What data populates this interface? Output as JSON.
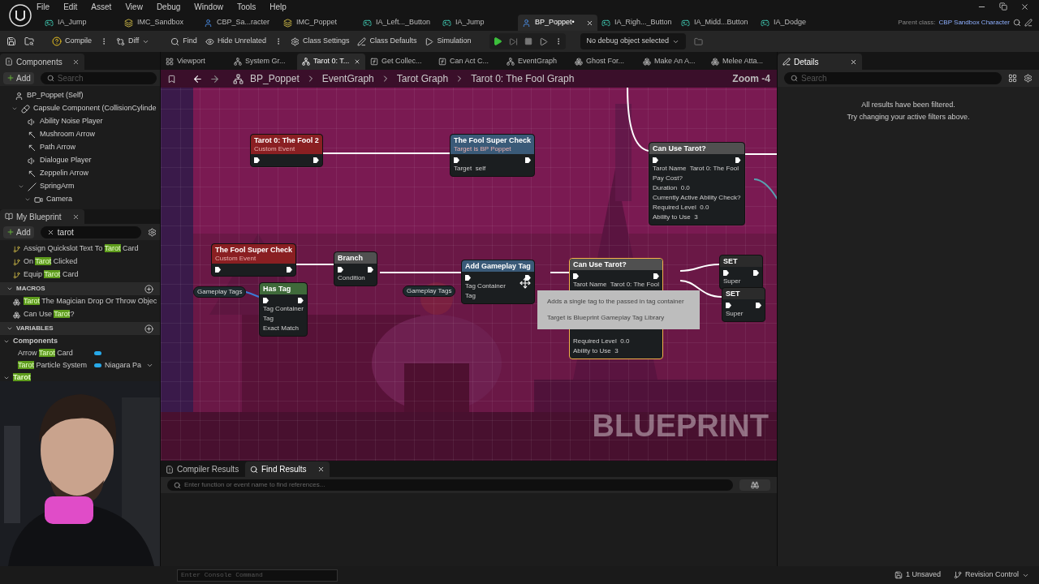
{
  "menu": [
    "File",
    "Edit",
    "Asset",
    "View",
    "Debug",
    "Window",
    "Tools",
    "Help"
  ],
  "file_tabs": [
    {
      "label": "IA_Jump",
      "kind": "action",
      "selected": false
    },
    {
      "label": "IMC_Sandbox",
      "kind": "mapping",
      "selected": false
    },
    {
      "label": "CBP_Sa...racter",
      "kind": "blueprint",
      "selected": false
    },
    {
      "label": "IMC_Poppet",
      "kind": "mapping",
      "selected": false
    },
    {
      "label": "IA_Left..._Button",
      "kind": "action",
      "selected": false
    },
    {
      "label": "IA_Jump",
      "kind": "action",
      "selected": false
    },
    {
      "label": "BP_Poppet•",
      "kind": "blueprint",
      "selected": true
    },
    {
      "label": "IA_Righ..._Button",
      "kind": "action",
      "selected": false
    },
    {
      "label": "IA_Midd...Button",
      "kind": "action",
      "selected": false
    },
    {
      "label": "IA_Dodge",
      "kind": "action",
      "selected": false
    }
  ],
  "parent_class": {
    "label": "Parent class:",
    "value": "CBP Sandbox Character"
  },
  "toolbar": {
    "compile": "Compile",
    "diff": "Diff",
    "find": "Find",
    "hide_unrelated": "Hide Unrelated",
    "class_settings": "Class Settings",
    "class_defaults": "Class Defaults",
    "simulation": "Simulation",
    "debug_select": "No debug object selected"
  },
  "components": {
    "title": "Components",
    "add": "Add",
    "search_placeholder": "Search",
    "tree": [
      {
        "label": "BP_Poppet (Self)",
        "kind": "self",
        "children": [
          {
            "label": "Capsule Component (CollisionCylinde",
            "kind": "capsule",
            "expanded": true,
            "children": [
              {
                "label": "Ability Noise Player",
                "kind": "audio"
              },
              {
                "label": "Mushroom Arrow",
                "kind": "arrow"
              },
              {
                "label": "Path Arrow",
                "kind": "arrow"
              },
              {
                "label": "Dialogue Player",
                "kind": "audio"
              },
              {
                "label": "Zeppelin Arrow",
                "kind": "arrow"
              },
              {
                "label": "SpringArm",
                "kind": "springarm",
                "expanded": true,
                "children": [
                  {
                    "label": "Camera",
                    "kind": "camera",
                    "expanded": true
                  }
                ]
              }
            ]
          }
        ]
      }
    ]
  },
  "my_blueprint": {
    "title": "My Blueprint",
    "add": "Add",
    "filter": "tarot",
    "functions": [
      {
        "parts": [
          {
            "text": "Assign Quickslot Text To ",
            "match": false
          },
          {
            "text": "Tarot",
            "match": true
          },
          {
            "text": " Card",
            "match": false
          }
        ]
      },
      {
        "parts": [
          {
            "text": "On ",
            "match": false
          },
          {
            "text": "Tarot",
            "match": true
          },
          {
            "text": " Clicked",
            "match": false
          }
        ]
      },
      {
        "parts": [
          {
            "text": "Equip ",
            "match": false
          },
          {
            "text": "Tarot",
            "match": true
          },
          {
            "text": " Card",
            "match": false
          }
        ]
      }
    ],
    "macros_header": "MACROS",
    "macros": [
      {
        "parts": [
          {
            "text": "Tarot",
            "match": true
          },
          {
            "text": " The Magician Drop Or Throw Objec",
            "match": false
          }
        ]
      },
      {
        "parts": [
          {
            "text": "Can Use ",
            "match": false
          },
          {
            "text": "Tarot",
            "match": true
          },
          {
            "text": "?",
            "match": false
          }
        ]
      }
    ],
    "variables_header": "VARIABLES",
    "categories": [
      {
        "parts": [
          {
            "text": "Components",
            "match": false
          }
        ],
        "expanded": true,
        "variables": [
          {
            "parts": [
              {
                "text": "Arrow ",
                "match": false
              },
              {
                "text": "Tarot",
                "match": true
              },
              {
                "text": " Card",
                "match": false
              }
            ],
            "color": "#27a8e8"
          },
          {
            "parts": [
              {
                "text": "Tarot",
                "match": true
              },
              {
                "text": " Particle System",
                "match": false
              }
            ],
            "color": "#27a8e8",
            "type": "Niagara Pa"
          }
        ]
      },
      {
        "parts": [
          {
            "text": "Tarot",
            "match": true
          }
        ],
        "expanded": true
      }
    ]
  },
  "doc_tabs": [
    {
      "label": "Viewport",
      "kind": "viewport",
      "selected": false
    },
    {
      "label": "System Gr...",
      "kind": "graph",
      "selected": false
    },
    {
      "label": "Tarot 0: T...",
      "kind": "graph",
      "selected": true
    },
    {
      "label": "Get Collec...",
      "kind": "function",
      "selected": false
    },
    {
      "label": "Can Act C...",
      "kind": "function",
      "selected": false
    },
    {
      "label": "EventGraph",
      "kind": "graph",
      "selected": false
    },
    {
      "label": "Ghost For...",
      "kind": "macro",
      "selected": false
    },
    {
      "label": "Make An A...",
      "kind": "macro",
      "selected": false
    },
    {
      "label": "Melee Atta...",
      "kind": "macro",
      "selected": false
    }
  ],
  "breadcrumb": [
    "BP_Poppet",
    "EventGraph",
    "Tarot Graph",
    "Tarot 0: The Fool Graph"
  ],
  "zoom": "Zoom -4",
  "graph_label": "BLUEPRINT",
  "nodes": [
    {
      "title": "Tarot 0: The Fool 2",
      "subtitle": "Custom Event",
      "kind": "event",
      "selected": false
    },
    {
      "title": "The Fool Super Check",
      "subtitle": "Target is BP Poppet",
      "kind": "function",
      "selected": false,
      "pins": [
        "Target  self"
      ]
    },
    {
      "title": "Can Use Tarot?",
      "kind": "macro",
      "selected": false,
      "pins": [
        "Tarot Name  Tarot 0: The Fool",
        "Pay Cost?",
        "Duration  0.0",
        "Currently Active Ability Check?",
        "Required Level  0.0",
        "Ability to Use  3"
      ]
    },
    {
      "title": "Gameplay Tags",
      "kind": "variable",
      "selected": false
    },
    {
      "title": "The Fool Super Check",
      "subtitle": "Custom Event",
      "kind": "event",
      "selected": false
    },
    {
      "title": "Has Tag",
      "kind": "pure",
      "selected": false,
      "pins": [
        "Tag Container",
        "Tag",
        "Exact Match"
      ]
    },
    {
      "title": "Branch",
      "kind": "macro",
      "selected": false,
      "pins": [
        "Condition"
      ]
    },
    {
      "title": "Gameplay Tags",
      "kind": "variable",
      "selected": false
    },
    {
      "title": "Add Gameplay Tag",
      "kind": "function",
      "selected": false,
      "pins": [
        "Tag Container",
        "Tag"
      ]
    },
    {
      "title": "Can Use Tarot?",
      "kind": "macro",
      "selected": true,
      "pins": [
        "Tarot Name  Tarot 0: The Fool",
        "Required Level  0.0",
        "Ability to Use  3"
      ]
    },
    {
      "title": "SET",
      "kind": "set",
      "selected": false,
      "pins": [
        "Super"
      ]
    },
    {
      "title": "SET",
      "kind": "set",
      "selected": false,
      "pins": [
        "Super"
      ]
    }
  ],
  "tooltip": [
    "Adds a single tag to the passed in tag container",
    "Target is Blueprint Gameplay Tag Library"
  ],
  "details": {
    "title": "Details",
    "search_placeholder": "Search",
    "message": [
      "All results have been filtered.",
      "Try changing your active filters above."
    ]
  },
  "bottom_tabs": [
    {
      "label": "Compiler Results",
      "kind": "compiler",
      "selected": false
    },
    {
      "label": "Find Results",
      "kind": "find",
      "selected": true
    }
  ],
  "find_placeholder": "Enter function or event name to find references...",
  "status": {
    "console_placeholder": "Enter Console Command",
    "unsaved": "1 Unsaved",
    "revision": "Revision Control"
  }
}
